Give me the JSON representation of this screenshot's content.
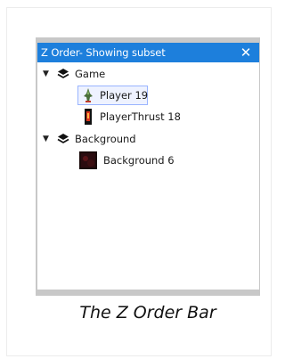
{
  "window": {
    "title": "Z Order- Showing subset",
    "close_glyph": "✕"
  },
  "tree": {
    "groups": [
      {
        "label": "Game",
        "icon": "layers-icon",
        "expanded": true,
        "items": [
          {
            "label": "Player 19",
            "selected": true,
            "thumb": "player-sprite-icon"
          },
          {
            "label": "PlayerThrust 18",
            "selected": false,
            "thumb": "thrust-sprite-icon"
          }
        ]
      },
      {
        "label": "Background",
        "icon": "layers-icon",
        "expanded": true,
        "items": [
          {
            "label": "Background 6",
            "selected": false,
            "thumb": "background-thumb-icon"
          }
        ]
      }
    ]
  },
  "caption": "The Z Order Bar",
  "colors": {
    "titlebar": "#1d7fdc",
    "panel_border": "#c8c8c8",
    "selection_border": "#99b4ff",
    "selection_fill": "#eef2ff"
  }
}
